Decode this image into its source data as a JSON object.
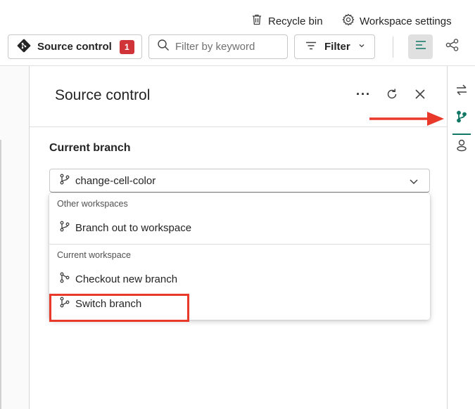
{
  "header": {
    "recycle_bin": "Recycle bin",
    "workspace_settings": "Workspace settings"
  },
  "toolbar": {
    "source_control_label": "Source control",
    "source_control_badge": "1",
    "filter_placeholder": "Filter by keyword",
    "filter_label": "Filter"
  },
  "panel": {
    "title": "Source control",
    "more_label": "···",
    "current_branch_label": "Current branch",
    "selected_branch": "change-cell-color",
    "menu": {
      "group_other": "Other workspaces",
      "branch_out": "Branch out to workspace",
      "group_current": "Current workspace",
      "checkout_new": "Checkout new branch",
      "switch_branch": "Switch branch"
    }
  },
  "colors": {
    "accent": "#117865",
    "badge": "#d13438",
    "callout": "#e8392b"
  },
  "icons": [
    "recycle-bin-icon",
    "gear-icon",
    "git-icon",
    "search-icon",
    "filter-icon",
    "chevron-down-icon",
    "list-view-icon",
    "lineage-icon",
    "refresh-icon",
    "close-icon",
    "branch-icon",
    "swap-icon",
    "storage-icon"
  ]
}
